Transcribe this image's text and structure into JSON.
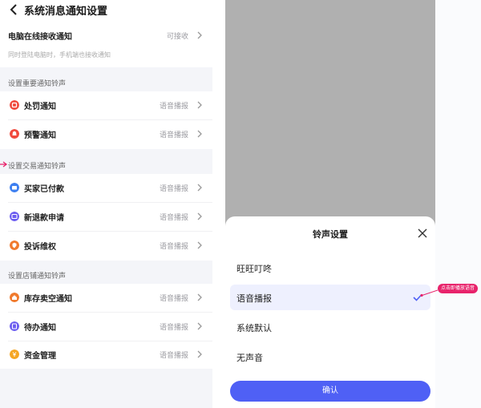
{
  "header": {
    "title": "系统消息通知设置"
  },
  "pc_row": {
    "title": "电脑在线接收通知",
    "value": "可接收",
    "desc": "同时登陆电脑时，手机端也接收通知"
  },
  "sections": [
    {
      "label": "设置重要通知铃声",
      "items": [
        {
          "title": "处罚通知",
          "value": "语音播报",
          "icon": "penalty-icon",
          "color": "#f04a3d"
        },
        {
          "title": "预警通知",
          "value": "语音播报",
          "icon": "bell-icon",
          "color": "#f04a3d"
        }
      ]
    },
    {
      "label": "设置交易通知铃声",
      "items": [
        {
          "title": "买家已付款",
          "value": "语音播报",
          "icon": "wallet-icon",
          "color": "#3d7ff0"
        },
        {
          "title": "新退款申请",
          "value": "语音播报",
          "icon": "refund-icon",
          "color": "#6b5cf0"
        },
        {
          "title": "投诉维权",
          "value": "语音播报",
          "icon": "complaint-icon",
          "color": "#f07a2d"
        }
      ]
    },
    {
      "label": "设置店铺通知铃声",
      "items": [
        {
          "title": "库存卖空通知",
          "value": "语音播报",
          "icon": "home-icon",
          "color": "#f07a2d"
        },
        {
          "title": "待办通知",
          "value": "语音播报",
          "icon": "todo-icon",
          "color": "#6b5cf0"
        },
        {
          "title": "资金管理",
          "value": "语音播报",
          "icon": "money-icon",
          "color": "#f5a623"
        }
      ]
    }
  ],
  "sheet": {
    "title": "铃声设置",
    "options": [
      "旺旺叮咚",
      "语音播报",
      "系统默认",
      "无声音"
    ],
    "selected": 1,
    "confirm": "确认"
  },
  "callout": "点击即播放语音",
  "colors": {
    "accent": "#4f60f5",
    "highlight": "#e8236b"
  }
}
